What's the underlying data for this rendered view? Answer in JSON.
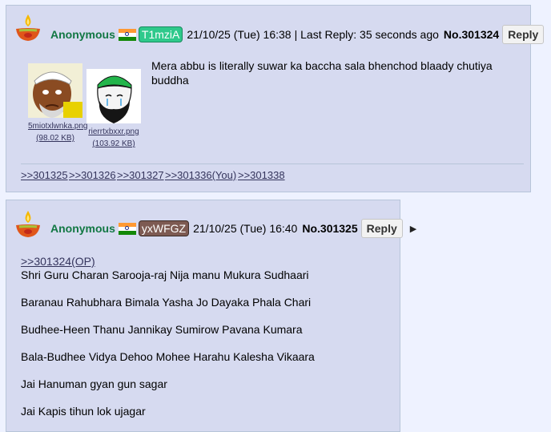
{
  "posts": [
    {
      "name": "Anonymous",
      "id_label": "T1mziA",
      "id_bg": "#2ec98b",
      "date": "21/10/25 (Tue) 16:38",
      "last_reply": "| Last Reply: 35 seconds ago",
      "number": "No.301324",
      "reply_label": "Reply",
      "files": [
        {
          "name": "5miotxlwnka.png",
          "size": "(98.02 KB)"
        },
        {
          "name": "rierrtxbxxr.png",
          "size": "(103.92 KB)"
        }
      ],
      "message": "Mera abbu is literally suwar ka baccha sala bhenchod blaady chutiya buddha",
      "backlinks": [
        ">>301325",
        ">>301326",
        ">>301327",
        ">>301336(You)",
        ">>301338"
      ]
    },
    {
      "name": "Anonymous",
      "id_label": "yxWFGZ",
      "id_bg": "#7d5a52",
      "date": "21/10/25 (Tue) 16:40",
      "number": "No.301325",
      "reply_label": "Reply",
      "quote_link": ">>301324(OP)",
      "lines": [
        "Shri Guru Charan Sarooja-raj Nija manu Mukura Sudhaari",
        "Baranau Rahubhara Bimala Yasha Jo Dayaka Phala Chari",
        "Budhee-Heen Thanu Jannikay Sumirow Pavana Kumara",
        "Bala-Budhee Vidya Dehoo Mohee Harahu Kalesha Vikaara",
        "Jai Hanuman gyan gun sagar",
        "Jai Kapis tihun lok ujagar"
      ]
    }
  ],
  "colors": {
    "name": "#117743",
    "link": "#34345c",
    "post_bg": "#d6daf0",
    "page_bg": "#eef2ff"
  },
  "icons": [
    "diya-icon",
    "india-flag-icon",
    "menu-arrow-icon"
  ]
}
